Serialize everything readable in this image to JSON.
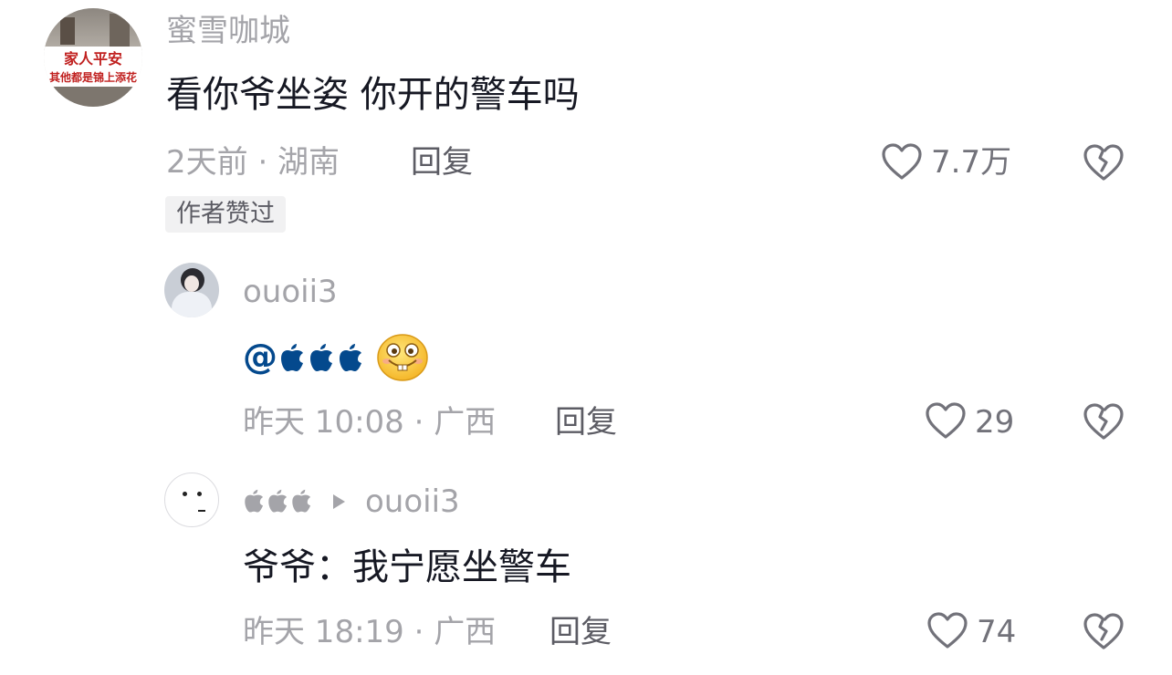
{
  "comments": [
    {
      "username": "蜜雪咖城",
      "avatar_text_1": "家人平安",
      "avatar_text_2": "其他都是锦上添花",
      "text": "看你爷坐姿 你开的警车吗",
      "meta": "2天前 · 湖南",
      "reply_label": "回复",
      "likes": "7.7万",
      "badge": "作者赞过"
    },
    {
      "username": "ouoii3",
      "mention": "@",
      "text_icons": "apple-icons",
      "emoji": "grinning-buck-tooth-emoji",
      "meta": "昨天 10:08 · 广西",
      "reply_label": "回复",
      "likes": "29"
    },
    {
      "username_reply_to": "ouoii3",
      "text": "爷爷：我宁愿坐警车",
      "meta": "昨天 18:19 · 广西",
      "reply_label": "回复",
      "likes": "74"
    }
  ],
  "colors": {
    "username": "#a4a4a9",
    "text": "#161823",
    "mention": "#04498d",
    "reply": "#5c5c64",
    "badge_bg": "#f1f1f2"
  }
}
